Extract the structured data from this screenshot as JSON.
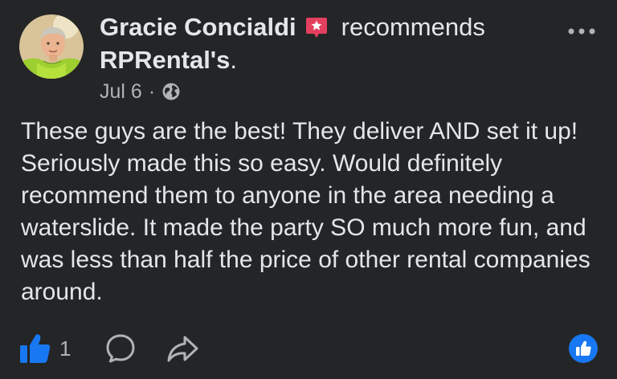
{
  "post": {
    "author_name": "Gracie Concialdi",
    "recommends_text": "recommends",
    "page_name": "RPRental's",
    "page_suffix": " .",
    "date": "Jul 6",
    "separator": "·",
    "body": "These guys are the best! They deliver AND set it up! Seriously made this so easy. Would definitely recommend them to anyone in the area needing a waterslide. It made the party SO much more fun, and was less than half the price of other rental companies around.",
    "like_count": "1"
  },
  "icons": {
    "badge": "recommendation-star-icon",
    "more": "more-options-icon",
    "privacy": "globe-icon",
    "like": "thumbs-up-icon",
    "comment": "comment-icon",
    "share": "share-icon",
    "reaction": "like-reaction-icon"
  },
  "colors": {
    "background": "#242526",
    "primary_text": "#e4e6eb",
    "secondary_text": "#b0b3b8",
    "accent_blue": "#1877f2",
    "badge_pink": "#e4405f"
  }
}
